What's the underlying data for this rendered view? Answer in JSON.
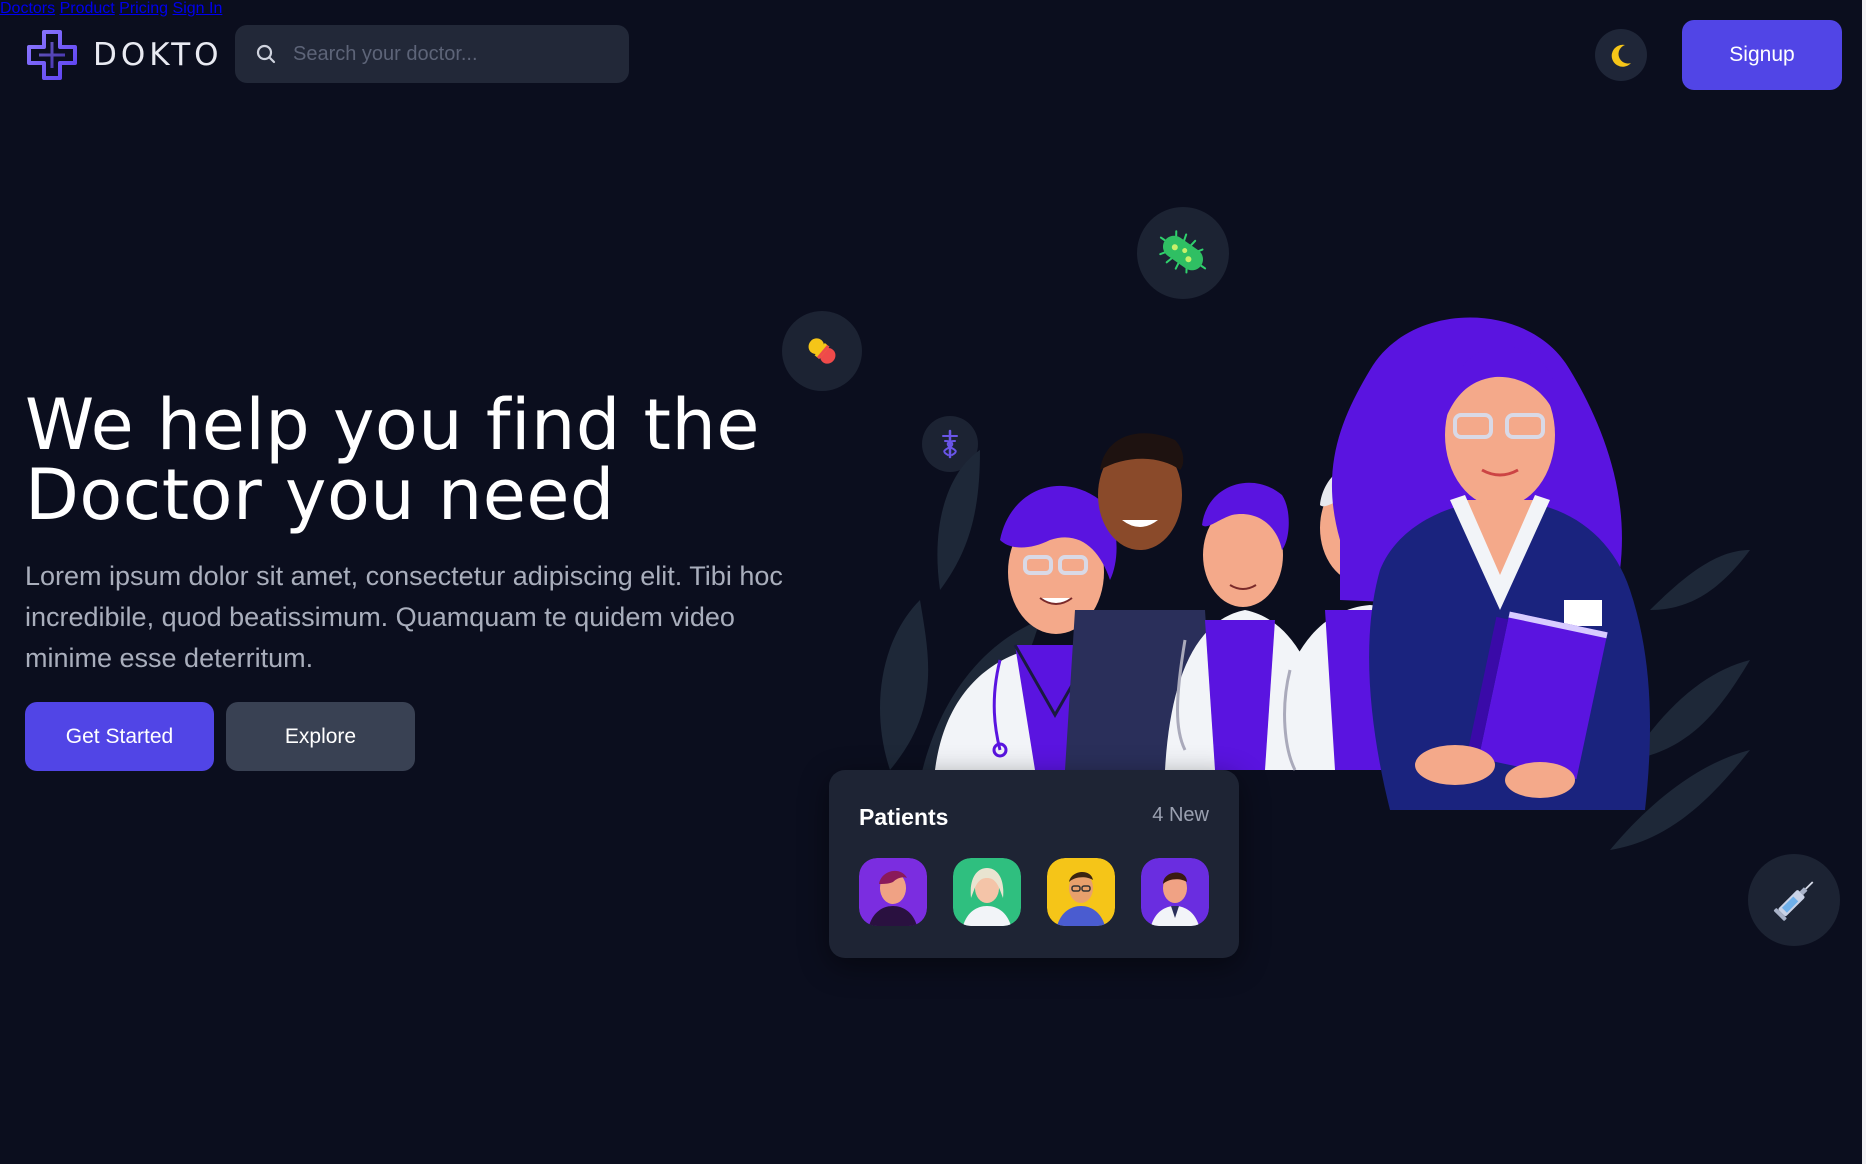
{
  "header": {
    "brand": "DOKTO",
    "search_placeholder": "Search your doctor...",
    "nav": [
      "Doctors",
      "Product",
      "Pricing",
      "Sign In"
    ],
    "signup_label": "Signup",
    "theme_icon": "moon-icon"
  },
  "hero": {
    "title_line1": "We help you find the",
    "title_line2": "Doctor you need",
    "description": "Lorem ipsum dolor sit amet, consectetur adipiscing elit. Tibi hoc incredibile, quod beatissimum. Quamquam te quidem video minime esse deterritum.",
    "primary_label": "Get Started",
    "secondary_label": "Explore"
  },
  "patients": {
    "title": "Patients",
    "badge": "4 New"
  },
  "floating_icons": [
    "pill-icon",
    "bacteria-icon",
    "caduceus-icon",
    "syringe-icon"
  ],
  "colors": {
    "background": "#0b0e1e",
    "accent": "#5145e6",
    "secondary_button": "#394153",
    "card": "#1e2434",
    "moon": "#f5c518"
  }
}
